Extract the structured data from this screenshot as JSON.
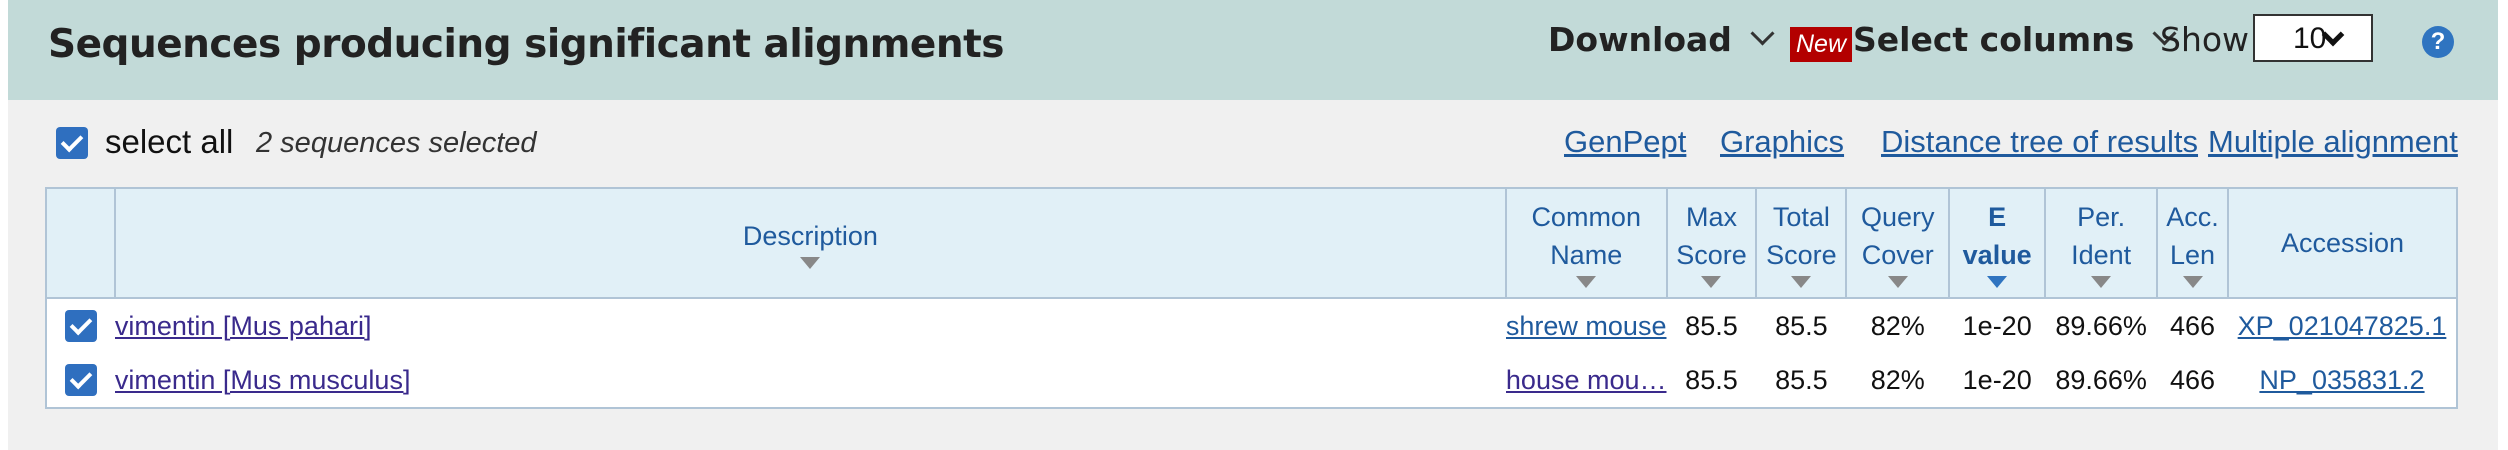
{
  "header": {
    "title": "Sequences producing significant alignments",
    "download_label": "Download",
    "new_badge": "New",
    "select_columns_label": "Select columns",
    "show_label": "Show",
    "show_value": "10",
    "help_icon": "?"
  },
  "toolbar": {
    "select_all_label": "select all",
    "selected_count": "2 sequences selected",
    "links": [
      "GenPept",
      "Graphics",
      "Distance tree of results",
      "Multiple alignment"
    ]
  },
  "table": {
    "columns": [
      {
        "label1": "Description",
        "label2": ""
      },
      {
        "label1": "Common",
        "label2": "Name"
      },
      {
        "label1": "Max",
        "label2": "Score"
      },
      {
        "label1": "Total",
        "label2": "Score"
      },
      {
        "label1": "Query",
        "label2": "Cover"
      },
      {
        "label1": "E",
        "label2": "value"
      },
      {
        "label1": "Per.",
        "label2": "Ident"
      },
      {
        "label1": "Acc.",
        "label2": "Len"
      },
      {
        "label1": "Accession",
        "label2": ""
      }
    ],
    "rows": [
      {
        "checked": true,
        "description": "vimentin [Mus pahari]",
        "common_name": "shrew mouse",
        "max_score": "85.5",
        "total_score": "85.5",
        "query_cover": "82%",
        "e_value": "1e-20",
        "per_ident": "89.66%",
        "acc_len": "466",
        "accession": "XP_021047825.1"
      },
      {
        "checked": true,
        "description": "vimentin [Mus musculus]",
        "common_name": "house mou…",
        "max_score": "85.5",
        "total_score": "85.5",
        "query_cover": "82%",
        "e_value": "1e-20",
        "per_ident": "89.66%",
        "acc_len": "466",
        "accession": "NP_035831.2"
      }
    ]
  },
  "colors": {
    "header_bg": "#c2dad8",
    "link": "#1f5a9d",
    "checkbox": "#2f6fbf",
    "new_badge": "#b30000"
  }
}
